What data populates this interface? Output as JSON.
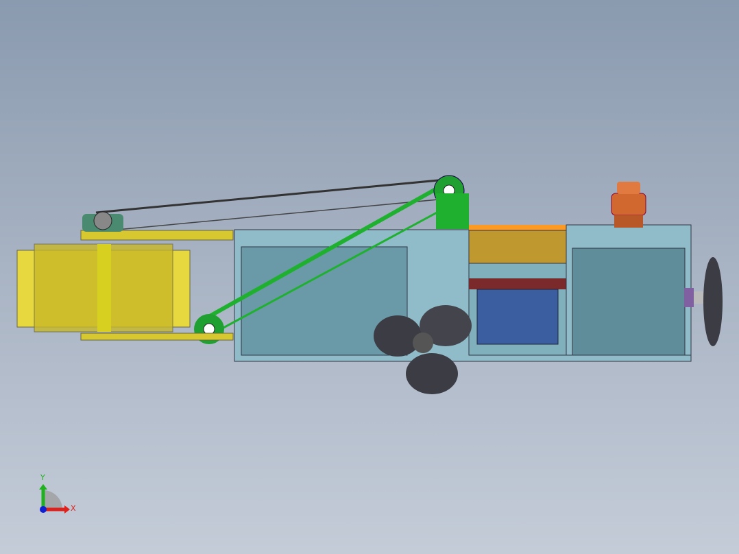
{
  "viewport": {
    "background_top": "#8a9aaf",
    "background_bottom": "#c4ccd8"
  },
  "triad": {
    "x_label": "X",
    "y_label": "Y",
    "x_color": "#e0201a",
    "y_color": "#20b020",
    "z_color": "#1020d0"
  },
  "model": {
    "hull_color": "#8fbcc8",
    "conveyor_color": "#20b030",
    "screen_color": "#d8c830",
    "battery_color": "#c09830",
    "panel_color": "#3a5ea0",
    "motor_color": "#d06830",
    "propeller_color": "#3c3c44"
  }
}
